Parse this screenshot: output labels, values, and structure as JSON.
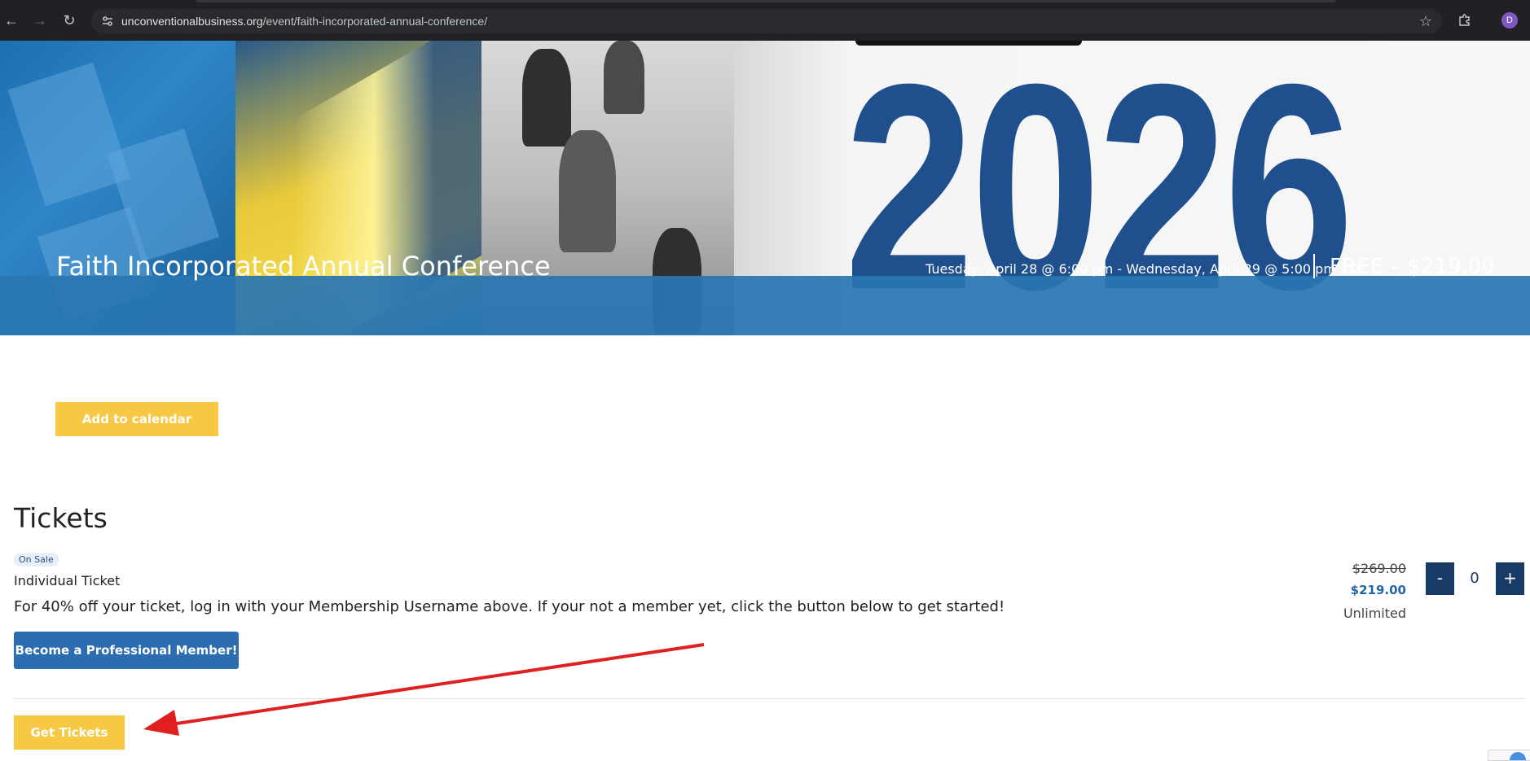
{
  "browser": {
    "url_domain": "unconventionalbusiness.org",
    "url_path": "/event/faith-incorporated-annual-conference/",
    "profile_initial": "D"
  },
  "hero": {
    "year_graphic": "2026",
    "title": "Faith Incorporated Annual Conference",
    "dates": "Tuesday, April 28 @ 6:00 pm - Wednesday, April 29 @ 5:00 pm CDT",
    "price_range": "FREE – $219.00"
  },
  "actions": {
    "add_to_calendar": "Add to calendar"
  },
  "tickets": {
    "heading": "Tickets",
    "badge": "On Sale",
    "name": "Individual Ticket",
    "description": "For 40% off your ticket, log in with your Membership Username above. If your not a member yet, click the button below to get started!",
    "member_button": "Become a Professional Member!",
    "original_price": "$269.00",
    "sale_price": "$219.00",
    "availability": "Unlimited",
    "quantity": "0",
    "minus_label": "-",
    "plus_label": "+",
    "get_tickets": "Get Tickets"
  },
  "colors": {
    "accent_yellow": "#f7c843",
    "member_blue": "#2b6db0",
    "hero_band": "#2976b2",
    "qty_navy": "#173b66",
    "annotation_arrow": "#e02020"
  }
}
